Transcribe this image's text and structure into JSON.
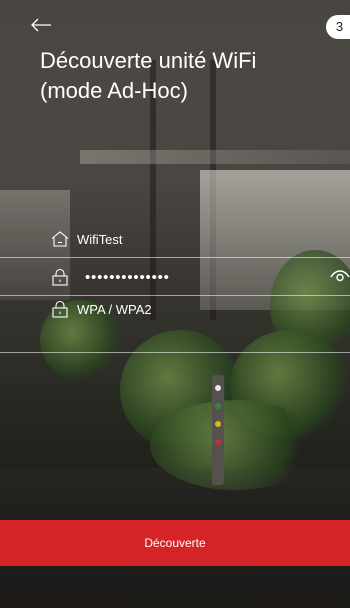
{
  "header": {
    "back_icon": "arrow-left-icon",
    "step_number": "3",
    "title_line1": "Découverte unité WiFi",
    "title_line2": "(mode Ad-Hoc)"
  },
  "form": {
    "ssid": {
      "icon": "home-icon",
      "value": "WifiTest"
    },
    "password": {
      "icon": "lock-icon",
      "value": "••••••••••••••",
      "toggle_icon": "eye-icon"
    },
    "security": {
      "icon": "lock-icon",
      "value": "WPA / WPA2"
    }
  },
  "action": {
    "label": "Découverte"
  },
  "colors": {
    "accent": "#d42427",
    "text": "#ffffff"
  }
}
